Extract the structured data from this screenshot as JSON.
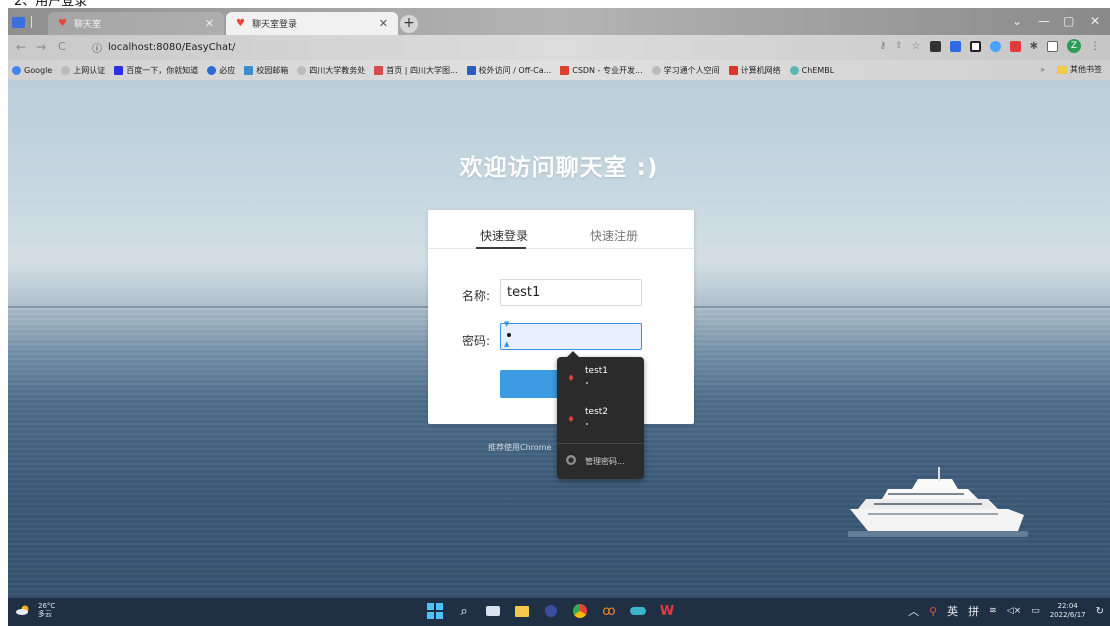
{
  "caption": "2、用户登录",
  "browser": {
    "tabs": [
      {
        "title": "聊天室",
        "active": false
      },
      {
        "title": "聊天室登录",
        "active": true
      }
    ],
    "url": "localhost:8080/EasyChat/",
    "bookmarks": [
      "Google",
      "上网认证",
      "百度一下，你就知道",
      "必应",
      "校园邮箱",
      "四川大学教务处",
      "首页 | 四川大学图...",
      "校外访问 / Off-Ca...",
      "CSDN - 专业开发...",
      "学习通个人空间",
      "计算机网络",
      "ChEMBL"
    ],
    "other_bookmarks": "其他书签",
    "profile_letter": "Z"
  },
  "page": {
    "title": "欢迎访问聊天室 :)",
    "tabs": {
      "login": "快速登录",
      "register": "快速注册"
    },
    "name_label": "名称:",
    "name_value": "test1",
    "password_label": "密码:",
    "login_button": "登",
    "hint": "推荐使用Chrome"
  },
  "autofill": {
    "entries": [
      "test1",
      "test2"
    ],
    "manage": "管理密码..."
  },
  "taskbar": {
    "temperature": "26°C",
    "weather": "多云",
    "ime_lang": "英",
    "ime_mode": "拼",
    "time": "22:04",
    "date": "2022/6/17"
  },
  "colors": {
    "accent": "#3c9be3",
    "taskbar": "#1f2f44"
  }
}
